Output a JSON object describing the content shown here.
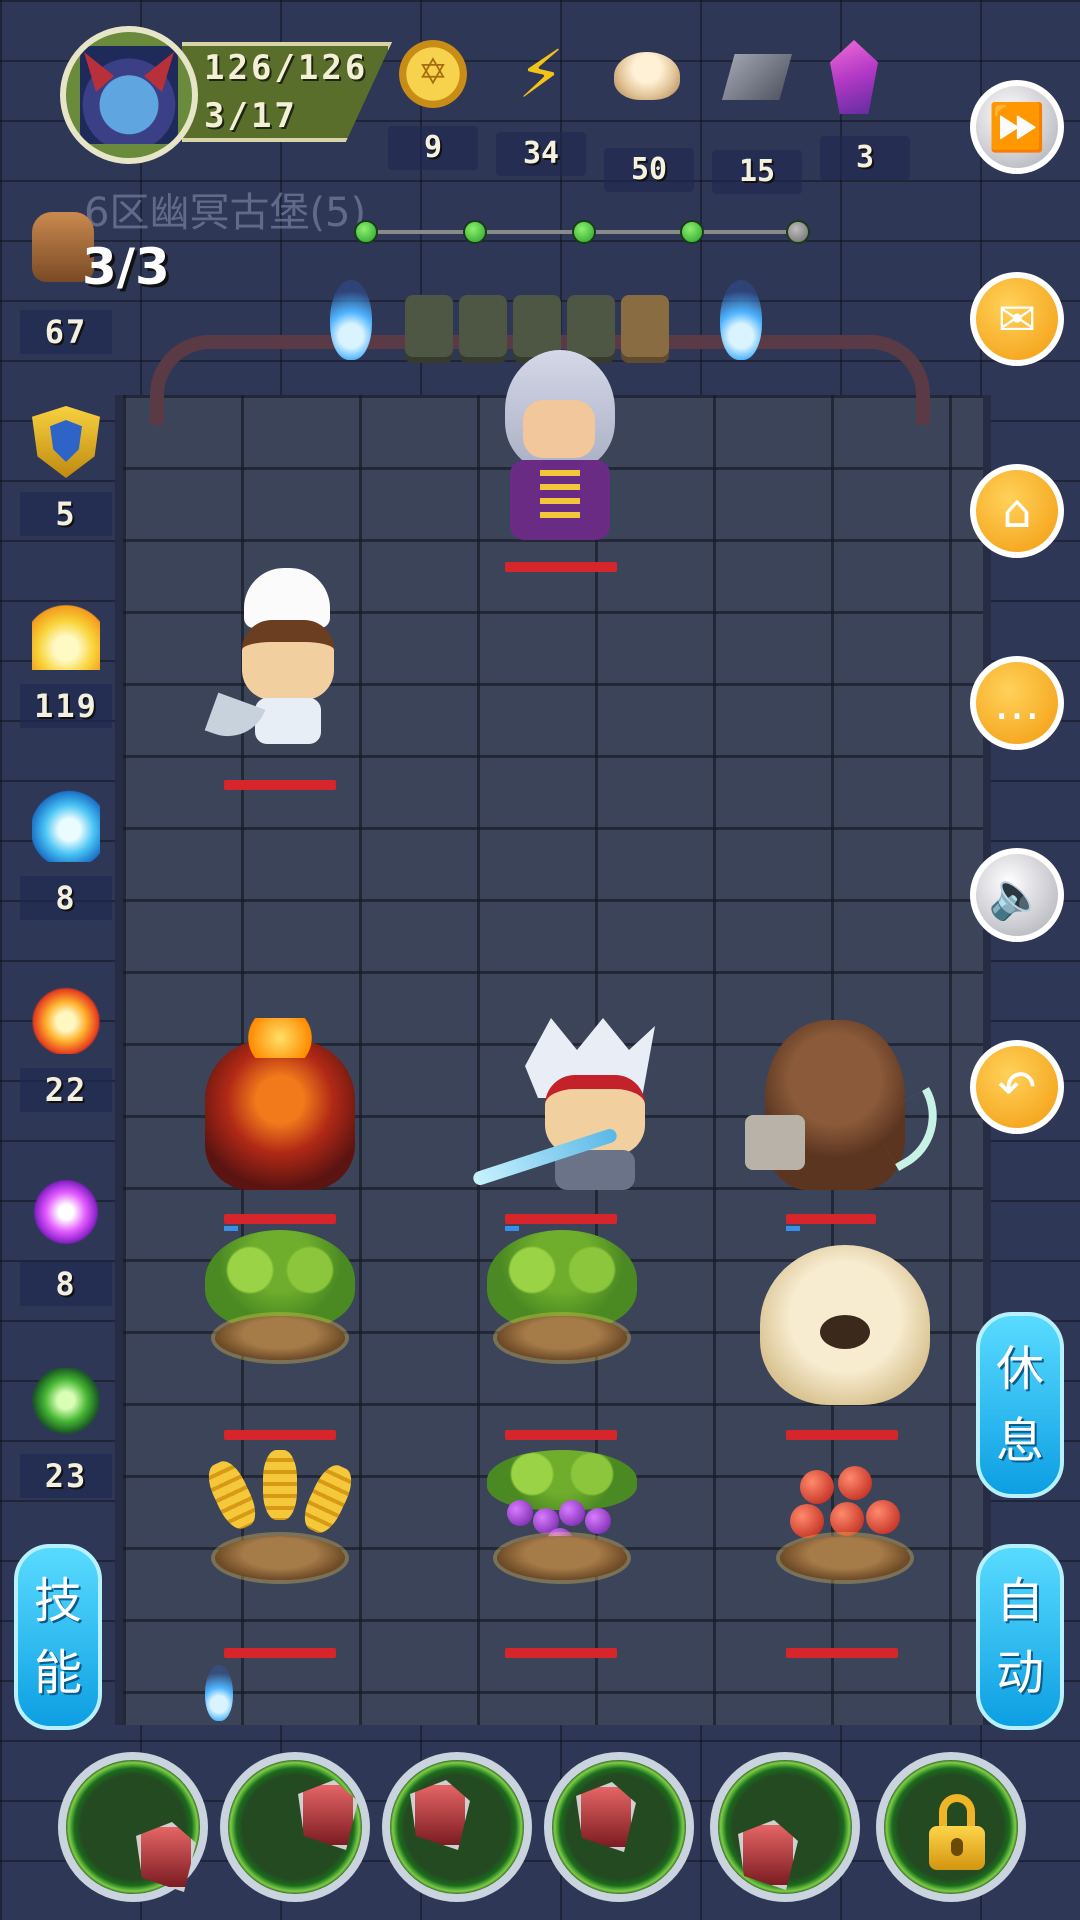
{
  "player": {
    "hp": "126/126",
    "level": "3/17"
  },
  "resources": [
    {
      "icon": "gold-coin-icon",
      "value": "9"
    },
    {
      "icon": "energy-bolt-icon",
      "value": "34"
    },
    {
      "icon": "steamed-bun-icon",
      "value": "50"
    },
    {
      "icon": "iron-ingot-icon",
      "value": "15"
    },
    {
      "icon": "crystal-gem-icon",
      "value": "3"
    }
  ],
  "stage": {
    "title": "6区幽冥古堡(5)",
    "attacks": "3/3"
  },
  "stage_progress": {
    "total_nodes": 5,
    "completed": 4
  },
  "side_stats": [
    {
      "icon": "fist-icon",
      "value": "67"
    },
    {
      "icon": "shield-icon",
      "value": "5"
    },
    {
      "icon": "holy-fire-icon",
      "value": "119"
    },
    {
      "icon": "water-wave-icon",
      "value": "8"
    },
    {
      "icon": "flame-icon",
      "value": "22"
    },
    {
      "icon": "lightning-icon",
      "value": "8"
    },
    {
      "icon": "poison-icon",
      "value": "23"
    }
  ],
  "right_buttons": [
    "fast-forward-icon",
    "mail-icon",
    "home-icon",
    "chat-icon",
    "sound-icon",
    "return-icon"
  ],
  "buttons": {
    "rest_line1": "休",
    "rest_line2": "息",
    "auto_line1": "自",
    "auto_line2": "动",
    "skill_line1": "技",
    "skill_line2": "能"
  },
  "skill_slots": [
    "skill-slot-1",
    "skill-slot-2",
    "skill-slot-3",
    "skill-slot-4",
    "skill-slot-5",
    "locked-slot"
  ],
  "colors": {
    "hp_bar": "#d6262c",
    "pill_button": "#19b2ef",
    "orange_button": "#f5a623"
  }
}
